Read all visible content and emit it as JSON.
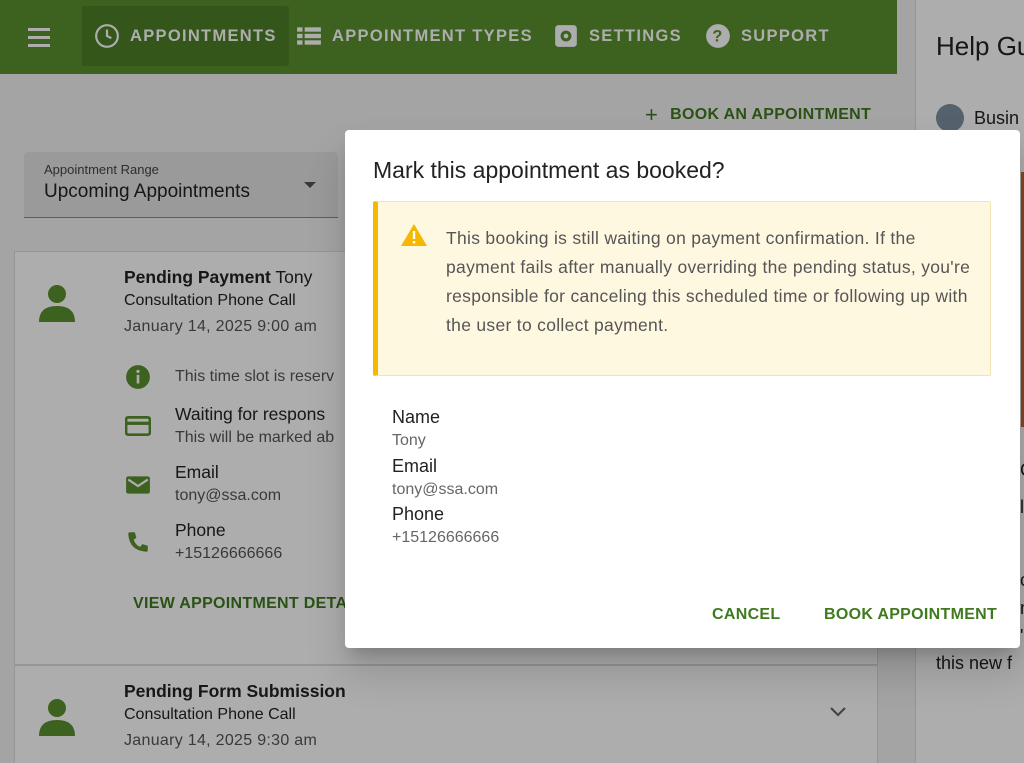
{
  "nav": {
    "items": [
      {
        "label": "APPOINTMENTS",
        "icon": "clock-icon",
        "active": true
      },
      {
        "label": "APPOINTMENT TYPES",
        "icon": "list-icon"
      },
      {
        "label": "SETTINGS",
        "icon": "gear-icon"
      },
      {
        "label": "SUPPORT",
        "icon": "help-icon"
      }
    ]
  },
  "page": {
    "book_link": "BOOK AN APPOINTMENT",
    "range_label": "Appointment Range",
    "range_value": "Upcoming Appointments"
  },
  "appointments": [
    {
      "status": "Pending Payment",
      "name": "Tony",
      "type": "Consultation Phone Call",
      "date": "January 14, 2025 9:00 am",
      "reserved_note": "This time slot is reserv",
      "waiting_title": "Waiting for respons",
      "waiting_sub": "This will be marked ab",
      "email_label": "Email",
      "email_value": "tony@ssa.com",
      "phone_label": "Phone",
      "phone_value": "+15126666666",
      "view_link": "VIEW APPOINTMENT DETAI"
    },
    {
      "status": "Pending Form Submission",
      "type": "Consultation Phone Call",
      "date": "January 14, 2025 9:30 am"
    }
  ],
  "help": {
    "title": "Help Gu",
    "business": "Busin",
    "frag1": "C",
    "frag2": "l",
    "frag3": "c",
    "frag4": "n",
    "frag5": "'s",
    "footer": "this new f"
  },
  "dialog": {
    "title": "Mark this appointment as booked?",
    "warning": "This booking is still waiting on payment confirmation. If the payment fails after manually overriding the pending status, you're responsible for canceling this scheduled time or following up with the user to collect payment.",
    "name_label": "Name",
    "name_value": "Tony",
    "email_label": "Email",
    "email_value": "tony@ssa.com",
    "phone_label": "Phone",
    "phone_value": "+15126666666",
    "cancel": "CANCEL",
    "confirm": "BOOK APPOINTMENT"
  },
  "colors": {
    "brand": "#5a8f2f",
    "accent": "#3f7a1f",
    "warning": "#f5b800"
  }
}
